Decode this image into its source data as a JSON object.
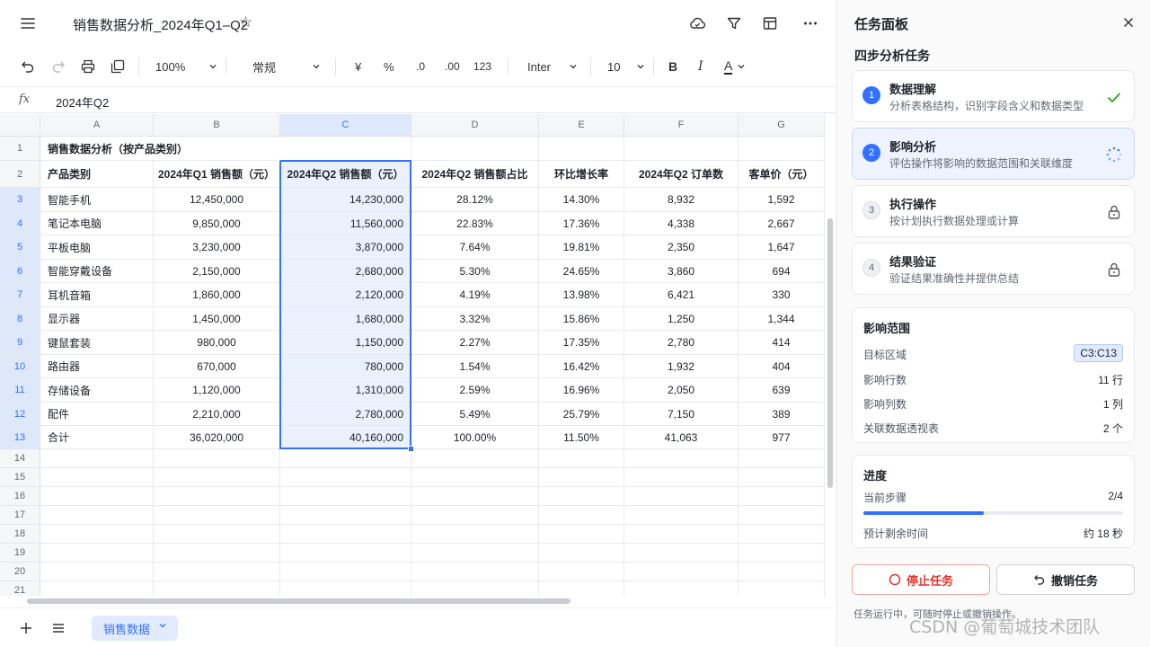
{
  "header": {
    "title": "销售数据分析_2024年Q1–Q2",
    "icons": [
      "menu-icon",
      "star-icon",
      "cloud-sync-icon",
      "filter-icon",
      "table-view-icon",
      "more-icon"
    ]
  },
  "toolbar": {
    "zoom": "100%",
    "number_format": "常规",
    "currency_symbol": "¥",
    "percent_symbol": "%",
    "decimal_decrease": ".0",
    "decimal_increase": ".00",
    "number_label": "123",
    "font_name": "Inter",
    "font_size": "10",
    "bold_label": "B",
    "italic_label": "I",
    "text_color_label": "A"
  },
  "formula_bar": {
    "fx_label": "fx",
    "value": "2024年Q2"
  },
  "sheet": {
    "columns": [
      "A",
      "B",
      "C",
      "D",
      "E",
      "F",
      "G"
    ],
    "selected_column": "C",
    "row_numbers": [
      "1",
      "2",
      "3",
      "4",
      "5",
      "6",
      "7",
      "8",
      "9",
      "10",
      "11",
      "12",
      "13",
      "14",
      "15",
      "16",
      "17",
      "18",
      "19",
      "20",
      "21"
    ],
    "title_cell": "销售数据分析（按产品类别）",
    "headers": [
      "产品类别",
      "2024年Q1 销售额（元）",
      "2024年Q2 销售额（元）",
      "2024年Q2 销售额占比",
      "环比增长率",
      "2024年Q2 订单数",
      "客单价（元）"
    ],
    "rows": [
      [
        "智能手机",
        "12,450,000",
        "14,230,000",
        "28.12%",
        "14.30%",
        "8,932",
        "1,592"
      ],
      [
        "笔记本电脑",
        "9,850,000",
        "11,560,000",
        "22.83%",
        "17.36%",
        "4,338",
        "2,667"
      ],
      [
        "平板电脑",
        "3,230,000",
        "3,870,000",
        "7.64%",
        "19.81%",
        "2,350",
        "1,647"
      ],
      [
        "智能穿戴设备",
        "2,150,000",
        "2,680,000",
        "5.30%",
        "24.65%",
        "3,860",
        "694"
      ],
      [
        "耳机音箱",
        "1,860,000",
        "2,120,000",
        "4.19%",
        "13.98%",
        "6,421",
        "330"
      ],
      [
        "显示器",
        "1,450,000",
        "1,680,000",
        "3.32%",
        "15.86%",
        "1,250",
        "1,344"
      ],
      [
        "键鼠套装",
        "980,000",
        "1,150,000",
        "2.27%",
        "17.35%",
        "2,780",
        "414"
      ],
      [
        "路由器",
        "670,000",
        "780,000",
        "1.54%",
        "16.42%",
        "1,932",
        "404"
      ],
      [
        "存储设备",
        "1,120,000",
        "1,310,000",
        "2.59%",
        "16.96%",
        "2,050",
        "639"
      ],
      [
        "配件",
        "2,210,000",
        "2,780,000",
        "5.49%",
        "25.79%",
        "7,150",
        "389"
      ],
      [
        "合计",
        "36,020,000",
        "40,160,000",
        "100.00%",
        "11.50%",
        "41,063",
        "977"
      ]
    ]
  },
  "bottom_bar": {
    "sheet_tab": "销售数据"
  },
  "task_panel": {
    "title": "任务面板",
    "subtitle": "四步分析任务",
    "steps": [
      {
        "num": "1",
        "title": "数据理解",
        "desc": "分析表格结构，识别字段含义和数据类型",
        "state": "done"
      },
      {
        "num": "2",
        "title": "影响分析",
        "desc": "评估操作将影响的数据范围和关联维度",
        "state": "running"
      },
      {
        "num": "3",
        "title": "执行操作",
        "desc": "按计划执行数据处理或计算",
        "state": "locked"
      },
      {
        "num": "4",
        "title": "结果验证",
        "desc": "验证结果准确性并提供总结",
        "state": "locked"
      }
    ],
    "impact": {
      "title": "影响范围",
      "target_label": "目标区域",
      "target_value": "C3:C13",
      "rows_label": "影响行数",
      "rows_value": "11 行",
      "cols_label": "影响列数",
      "cols_value": "1 列",
      "pivot_label": "关联数据透视表",
      "pivot_value": "2 个"
    },
    "progress": {
      "title": "进度",
      "step_label": "当前步骤",
      "step_value": "2/4",
      "fraction": 0.5,
      "remaining_label": "预计剩余时间",
      "remaining_value": "约 18 秒"
    },
    "stop_label": "停止任务",
    "undo_label": "撤销任务",
    "note": "任务运行中，可随时停止或撤销操作。"
  },
  "watermark": "CSDN @葡萄城技术团队",
  "colors": {
    "accent": "#3370ff",
    "danger": "#e5362b",
    "success": "#2ea121",
    "selection_fill": "#eaf1fd"
  }
}
